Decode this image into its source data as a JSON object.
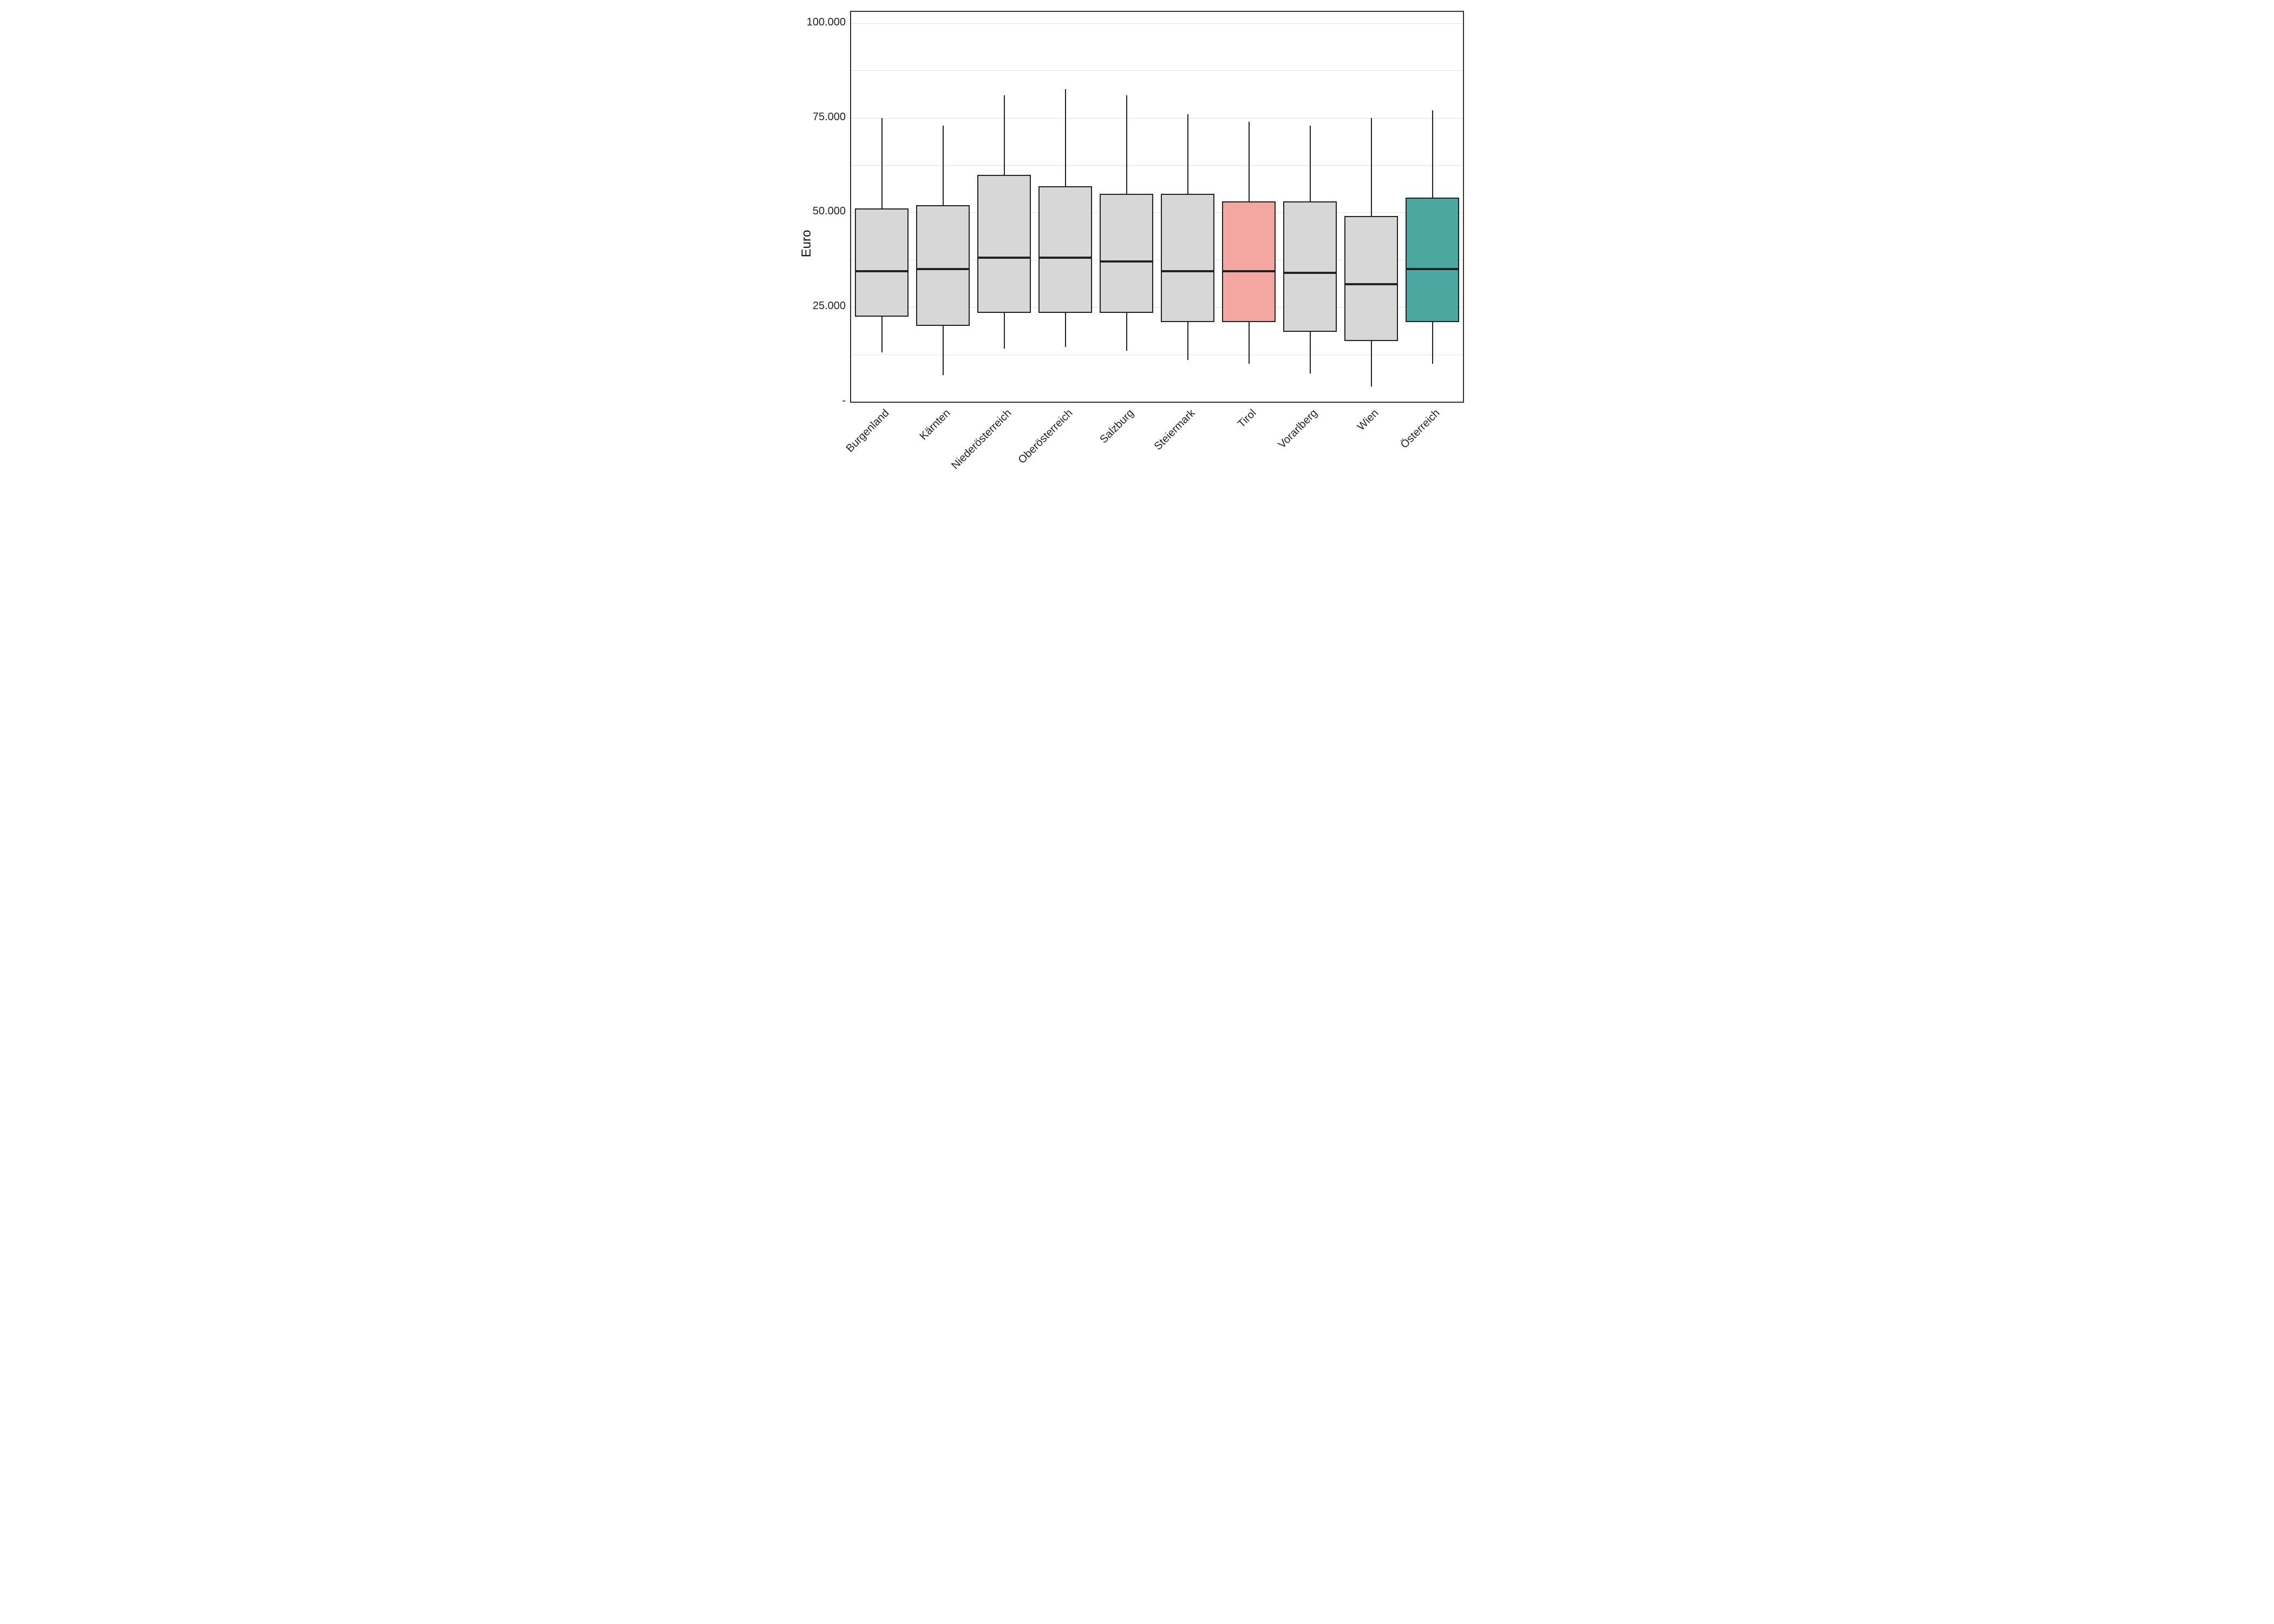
{
  "chart_data": {
    "type": "box",
    "ylabel": "Euro",
    "xlabel": "",
    "ylim": [
      0,
      103000
    ],
    "yticks": [
      {
        "v": 0,
        "label": "-"
      },
      {
        "v": 25000,
        "label": "25.000"
      },
      {
        "v": 50000,
        "label": "50.000"
      },
      {
        "v": 75000,
        "label": "75.000"
      },
      {
        "v": 100000,
        "label": "100.000"
      }
    ],
    "gridlines": [
      0,
      12500,
      25000,
      37500,
      50000,
      62500,
      75000,
      87500,
      100000
    ],
    "series": [
      {
        "name": "Burgenland",
        "low": 13000,
        "q1": 22500,
        "median": 34500,
        "q3": 51000,
        "high": 75000,
        "color": "grey"
      },
      {
        "name": "Kärnten",
        "low": 7000,
        "q1": 20000,
        "median": 35000,
        "q3": 52000,
        "high": 73000,
        "color": "grey"
      },
      {
        "name": "Niederösterreich",
        "low": 14000,
        "q1": 23500,
        "median": 38000,
        "q3": 60000,
        "high": 81000,
        "color": "grey"
      },
      {
        "name": "Oberösterreich",
        "low": 14500,
        "q1": 23500,
        "median": 38000,
        "q3": 57000,
        "high": 82500,
        "color": "grey"
      },
      {
        "name": "Salzburg",
        "low": 13500,
        "q1": 23500,
        "median": 37000,
        "q3": 55000,
        "high": 81000,
        "color": "grey"
      },
      {
        "name": "Steiermark",
        "low": 11000,
        "q1": 21000,
        "median": 34500,
        "q3": 55000,
        "high": 76000,
        "color": "grey"
      },
      {
        "name": "Tirol",
        "low": 10000,
        "q1": 21000,
        "median": 34500,
        "q3": 53000,
        "high": 74000,
        "color": "salmon"
      },
      {
        "name": "Vorarlberg",
        "low": 7500,
        "q1": 18500,
        "median": 34000,
        "q3": 53000,
        "high": 73000,
        "color": "grey"
      },
      {
        "name": "Wien",
        "low": 4000,
        "q1": 16000,
        "median": 31000,
        "q3": 49000,
        "high": 75000,
        "color": "grey"
      },
      {
        "name": "Österreich",
        "low": 10000,
        "q1": 21000,
        "median": 35000,
        "q3": 54000,
        "high": 77000,
        "color": "teal"
      }
    ]
  }
}
